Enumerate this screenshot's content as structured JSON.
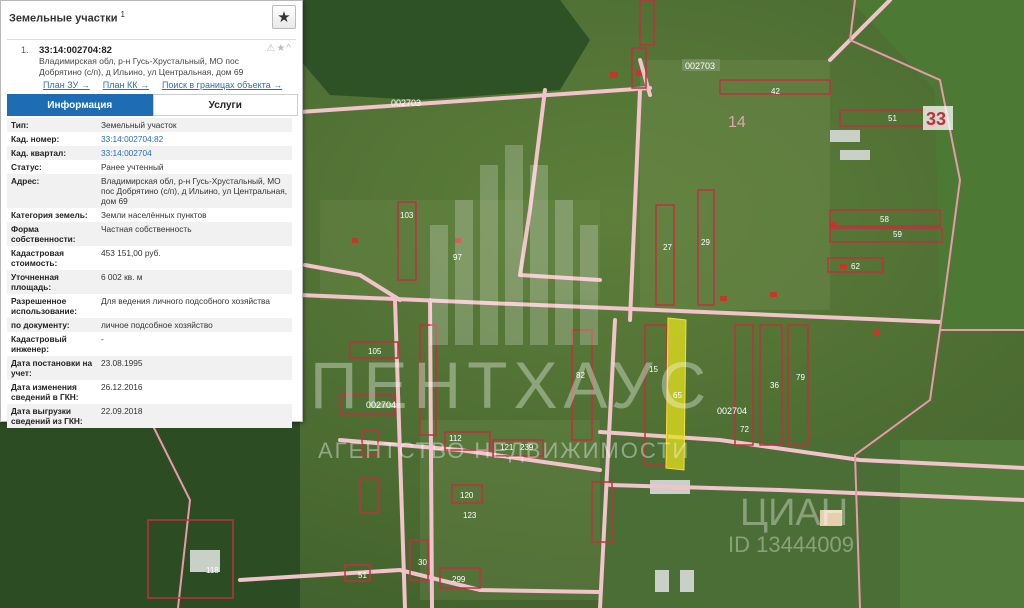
{
  "panel": {
    "title": "Земельные участки",
    "count": "1",
    "item_index": "1.",
    "cad_number": "33:14:002704:82",
    "address": "Владимирская обл, р-н Гусь-Хрустальный, МО пос Добрятино (с/п), д Ильино, ул Центральная, дом 69",
    "links": [
      "План ЗУ →",
      "План КК →",
      "Поиск в границах объекта →"
    ],
    "tabs": [
      "Информация",
      "Услуги"
    ],
    "fields": [
      {
        "key": "Тип:",
        "value": "Земельный участок"
      },
      {
        "key": "Кад. номер:",
        "value": "33:14:002704:82",
        "link": true
      },
      {
        "key": "Кад. квартал:",
        "value": "33:14:002704",
        "link": true
      },
      {
        "key": "Статус:",
        "value": "Ранее учтенный"
      },
      {
        "key": "Адрес:",
        "value": "Владимирская обл, р-н Гусь-Хрустальный, МО пос Добрятино (с/п), д Ильино, ул Центральная, дом 69"
      },
      {
        "key": "Категория земель:",
        "value": "Земли населённых пунктов"
      },
      {
        "key": "Форма собственности:",
        "value": "Частная собственность"
      },
      {
        "key": "Кадастровая стоимость:",
        "value": "453 151,00 руб."
      },
      {
        "key": "Уточненная площадь:",
        "value": "6 002 кв. м"
      },
      {
        "key": "Разрешенное использование:",
        "value": "Для ведения личного подсобного хозяйства"
      },
      {
        "key": "по документу:",
        "value": "личное подсобное хозяйство"
      },
      {
        "key": "Кадастровый инженер:",
        "value": "-"
      },
      {
        "key": "Дата постановки на учет:",
        "value": "23.08.1995"
      },
      {
        "key": "Дата изменения сведений в ГКН:",
        "value": "26.12.2016"
      },
      {
        "key": "Дата выгрузки сведений из ГКН:",
        "value": "22.09.2018"
      }
    ]
  },
  "map": {
    "quarter_labels": [
      "002703",
      "002703",
      "002704",
      "002704"
    ],
    "district_labels": [
      "14",
      "33"
    ],
    "parcel_numbers": [
      "42",
      "51",
      "58",
      "59",
      "62",
      "27",
      "29",
      "97",
      "103",
      "105",
      "112",
      "121",
      "239",
      "120",
      "123",
      "118",
      "30",
      "51",
      "299",
      "15",
      "82",
      "79",
      "36",
      "65",
      "72"
    ],
    "watermark_main": "ПЕНТХАУС",
    "watermark_sub": "АГЕНТСТВО НЕДВИЖИМОСТИ",
    "watermark_corner": "ЦИАН",
    "watermark_id": "ID 13444009"
  }
}
